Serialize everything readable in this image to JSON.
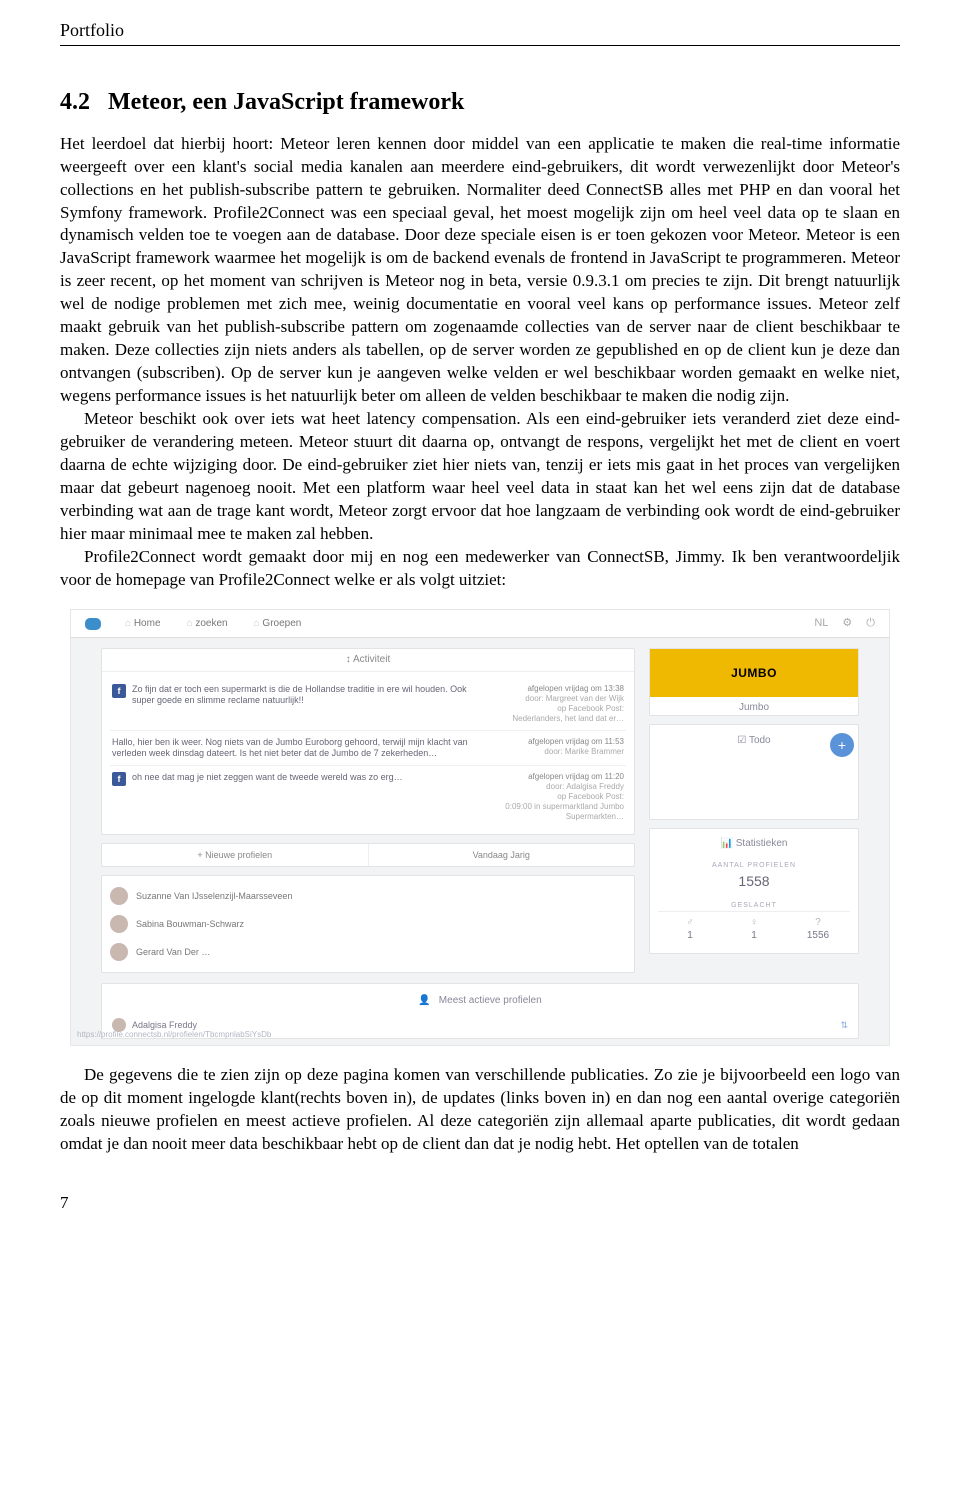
{
  "header": "Portfolio",
  "section": {
    "number": "4.2",
    "title": "Meteor, een JavaScript framework"
  },
  "paragraphs": {
    "p1": "Het leerdoel dat hierbij hoort: Meteor leren kennen door middel van een applicatie te maken die real-time informatie weergeeft over een klant's social media kanalen aan meerdere eind-gebruikers, dit wordt verwezenlijkt door Meteor's collections en het publish-subscribe pattern te gebruiken. Normaliter deed ConnectSB alles met PHP en dan vooral het Symfony framework. Profile2Connect was een speciaal geval, het moest mogelijk zijn om heel veel data op te slaan en dynamisch velden toe te voegen aan de database. Door deze speciale eisen is er toen gekozen voor Meteor. Meteor is een JavaScript framework waarmee het mogelijk is om de backend evenals de frontend in JavaScript te programmeren. Meteor is zeer recent, op het moment van schrijven is Meteor nog in beta, versie 0.9.3.1 om precies te zijn. Dit brengt natuurlijk wel de nodige problemen met zich mee, weinig documentatie en vooral veel kans op performance issues. Meteor zelf maakt gebruik van het publish-subscribe pattern om zogenaamde collecties van de server naar de client beschikbaar te maken. Deze collecties zijn niets anders als tabellen, op de server worden ze gepublished en op de client kun je deze dan ontvangen (subscriben). Op de server kun je aangeven welke velden er wel beschikbaar worden gemaakt en welke niet, wegens performance issues is het natuurlijk beter om alleen de velden beschikbaar te maken die nodig zijn.",
    "p2": "Meteor beschikt ook over iets wat heet latency compensation. Als een eind-gebruiker iets veranderd ziet deze eind-gebruiker de verandering meteen. Meteor stuurt dit daarna op, ontvangt de respons, vergelijkt het met de client en voert daarna de echte wijziging door. De eind-gebruiker ziet hier niets van, tenzij er iets mis gaat in het proces van vergelijken maar dat gebeurt nagenoeg nooit. Met een platform waar heel veel data in staat kan het wel eens zijn dat de database verbinding wat aan de trage kant wordt, Meteor zorgt ervoor dat hoe langzaam de verbinding ook wordt de eind-gebruiker hier maar minimaal mee te maken zal hebben.",
    "p3": "Profile2Connect wordt gemaakt door mij en nog een medewerker van ConnectSB, Jimmy. Ik ben verantwoordeljik voor de homepage van Profile2Connect welke er als volgt uitziet:",
    "p4": "De gegevens die te zien zijn op deze pagina komen van verschillende publicaties. Zo zie je bijvoorbeeld een logo van de op dit moment ingelogde klant(rechts boven in), de updates (links boven in) en dan nog een aantal overige categoriën zoals nieuwe profielen en meest actieve profielen. Al deze categoriën zijn allemaal aparte publicaties, dit wordt gedaan omdat je dan nooit meer data beschikbaar hebt op de client dan dat je nodig hebt. Het optellen van de totalen"
  },
  "app": {
    "nav": {
      "home": "Home",
      "zoeken": "zoeken",
      "groepen": "Groepen",
      "lang": "NL"
    },
    "activity_header": "Activiteit",
    "feed": [
      {
        "text": "Zo fijn dat er toch een supermarkt is die de Hollandse traditie in ere wil houden. Ook super goede en slimme reclame natuurlijk!!",
        "meta_time": "afgelopen vrijdag om 13:38",
        "meta_door": "door: Margreet van der Wijk",
        "meta_op": "op Facebook Post:",
        "meta_sub": "Nederlanders, het land dat er…",
        "fb": true
      },
      {
        "text": "Hallo, hier ben ik weer. Nog niets van de Jumbo Euroborg gehoord, terwijl mijn klacht van verleden week dinsdag dateert. Is het niet beter dat de Jumbo de 7 zekerheden…",
        "meta_time": "afgelopen vrijdag om 11:53",
        "meta_door": "door: Marike Brammer",
        "meta_op": "",
        "meta_sub": "",
        "fb": false
      },
      {
        "text": "oh nee dat mag je niet zeggen want de tweede wereld was zo erg…",
        "meta_time": "afgelopen vrijdag om 11:20",
        "meta_door": "door: Adalgisa Freddy",
        "meta_op": "op Facebook Post:",
        "meta_sub": "0:09:00 in supermarktland Jumbo Supermarkten…",
        "fb": true
      }
    ],
    "jumbo": "JUMBO",
    "jumbo_label": "Jumbo",
    "todo": "Todo",
    "split": {
      "left": "+ Nieuwe profielen",
      "right": "Vandaag Jarig"
    },
    "profiles": [
      "Suzanne Van IJsselenzijl-Maarsseveen",
      "Sabina Bouwman-Schwarz",
      "Gerard Van Der …"
    ],
    "stats": {
      "header": "Statistieken",
      "aantal_label": "AANTAL PROFIELEN",
      "aantal_value": "1558",
      "geslacht_label": "GESLACHT",
      "m": "1",
      "f": "1",
      "u": "1556"
    },
    "active_header": "Meest actieve profielen",
    "active_name": "Adalgisa Freddy",
    "url": "https://profile.connectsb.nl/profielen/TbcmpnlabSiYsDb"
  },
  "page_number": "7"
}
